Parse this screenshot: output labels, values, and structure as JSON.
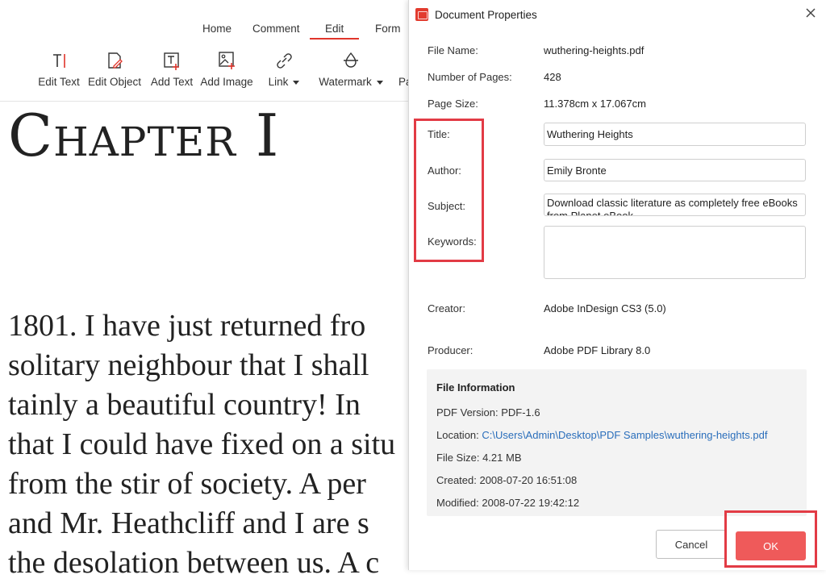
{
  "menu": {
    "tabs": [
      {
        "label": "Home"
      },
      {
        "label": "Comment"
      },
      {
        "label": "Edit"
      },
      {
        "label": "Form"
      }
    ],
    "active_tab": "Edit"
  },
  "toolbar": {
    "edit_text": "Edit Text",
    "edit_object": "Edit Object",
    "add_text": "Add Text",
    "add_image": "Add Image",
    "link": "Link",
    "watermark": "Watermark",
    "truncated": "Pa"
  },
  "document": {
    "chapter_title": "Chapter I",
    "lines": [
      {
        "text": "1801. I have just returned fro"
      },
      {
        "text": "solitary neighbour that I shall"
      },
      {
        "text": "tainly a beautiful country! In"
      },
      {
        "text": "that I could have fixed on a situ"
      },
      {
        "text": "from the stir of society. A per"
      },
      {
        "text": "and Mr. Heathcliff and I are s"
      },
      {
        "text": "the desolation between us. A c"
      }
    ]
  },
  "dialog": {
    "title": "Document Properties",
    "labels": {
      "file_name": "File Name:",
      "pages": "Number of Pages:",
      "page_size": "Page Size:",
      "title": "Title:",
      "author": "Author:",
      "subject": "Subject:",
      "keywords": "Keywords:",
      "creator": "Creator:",
      "producer": "Producer:"
    },
    "values": {
      "file_name": "wuthering-heights.pdf",
      "pages": "428",
      "page_size": "11.378cm x 17.067cm",
      "title": "Wuthering Heights",
      "author": "Emily Bronte",
      "subject": "Download classic literature as completely free eBooks from Planet eBook",
      "keywords": "",
      "creator": "Adobe InDesign CS3 (5.0)",
      "producer": "Adobe PDF Library 8.0"
    },
    "file_info": {
      "heading": "File Information",
      "pdf_version": "PDF Version: PDF-1.6",
      "location_label": "Location:",
      "location_path": "C:\\Users\\Admin\\Desktop\\PDF Samples\\wuthering-heights.pdf",
      "file_size": "File Size: 4.21 MB",
      "created": "Created: 2008-07-20 16:51:08",
      "modified": "Modified: 2008-07-22 19:42:12"
    },
    "buttons": {
      "cancel": "Cancel",
      "ok": "OK"
    }
  },
  "colors": {
    "accent": "#e0352b",
    "highlight": "#e23b45",
    "ok_button": "#ef5a5a",
    "link": "#2a6ebb"
  }
}
